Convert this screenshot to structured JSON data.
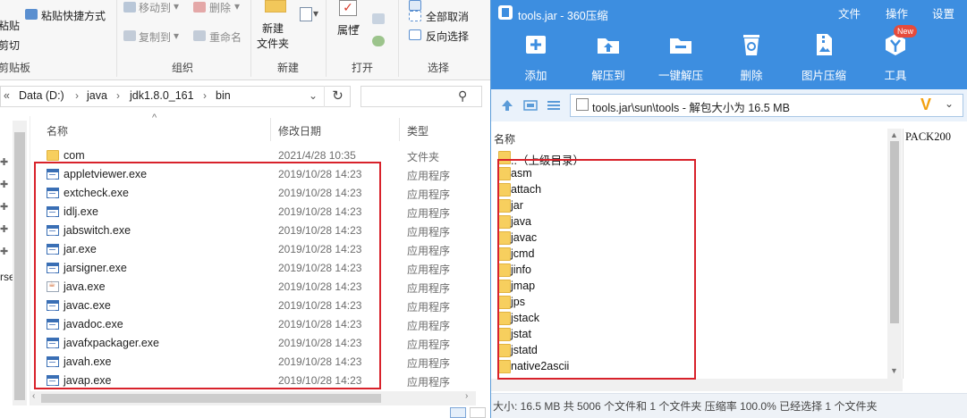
{
  "explorer": {
    "ribbon": {
      "paste_label": "粘贴",
      "paste_shortcut": "粘贴快捷方式",
      "cut": "剪切",
      "clipboard_group": "剪贴板",
      "move_to": "移动到",
      "copy_to": "复制到",
      "delete": "删除",
      "rename": "重命名",
      "organize_group": "组织",
      "new_folder": "新建\n文件夹",
      "new_folder_l1": "新建",
      "new_folder_l2": "文件夹",
      "new_group": "新建",
      "properties": "属性",
      "open_group": "打开",
      "select_all": "全部选择",
      "select_none": "全部取消",
      "invert_selection": "反向选择",
      "select_group": "选择"
    },
    "address": {
      "crumbs": [
        "Data (D:)",
        "java",
        "jdk1.8.0_161",
        "bin"
      ],
      "prefix": "«"
    },
    "columns": {
      "name": "名称",
      "date": "修改日期",
      "type": "类型"
    },
    "nav_label": "rse",
    "files": [
      {
        "name": "com",
        "date": "2021/4/28 10:35",
        "type": "文件夹",
        "icon": "folder"
      },
      {
        "name": "appletviewer.exe",
        "date": "2019/10/28 14:23",
        "type": "应用程序",
        "icon": "exe"
      },
      {
        "name": "extcheck.exe",
        "date": "2019/10/28 14:23",
        "type": "应用程序",
        "icon": "exe"
      },
      {
        "name": "idlj.exe",
        "date": "2019/10/28 14:23",
        "type": "应用程序",
        "icon": "exe"
      },
      {
        "name": "jabswitch.exe",
        "date": "2019/10/28 14:23",
        "type": "应用程序",
        "icon": "exe"
      },
      {
        "name": "jar.exe",
        "date": "2019/10/28 14:23",
        "type": "应用程序",
        "icon": "exe"
      },
      {
        "name": "jarsigner.exe",
        "date": "2019/10/28 14:23",
        "type": "应用程序",
        "icon": "exe"
      },
      {
        "name": "java.exe",
        "date": "2019/10/28 14:23",
        "type": "应用程序",
        "icon": "java"
      },
      {
        "name": "javac.exe",
        "date": "2019/10/28 14:23",
        "type": "应用程序",
        "icon": "exe"
      },
      {
        "name": "javadoc.exe",
        "date": "2019/10/28 14:23",
        "type": "应用程序",
        "icon": "exe"
      },
      {
        "name": "javafxpackager.exe",
        "date": "2019/10/28 14:23",
        "type": "应用程序",
        "icon": "exe"
      },
      {
        "name": "javah.exe",
        "date": "2019/10/28 14:23",
        "type": "应用程序",
        "icon": "exe"
      },
      {
        "name": "javap.exe",
        "date": "2019/10/28 14:23",
        "type": "应用程序",
        "icon": "exe"
      }
    ]
  },
  "zip": {
    "title": "tools.jar - 360压缩",
    "menu": [
      "文件",
      "操作",
      "设置"
    ],
    "toolbar": [
      {
        "label": "添加",
        "icon": "add-icon"
      },
      {
        "label": "解压到",
        "icon": "extract-to-icon"
      },
      {
        "label": "一键解压",
        "icon": "one-click-extract-icon"
      },
      {
        "label": "删除",
        "icon": "recycle-icon"
      },
      {
        "label": "图片压缩",
        "icon": "image-compress-icon"
      },
      {
        "label": "工具",
        "icon": "tools-icon"
      }
    ],
    "new_badge": "New",
    "path": "tools.jar\\sun\\tools - 解包大小为 16.5 MB",
    "column_name": "名称",
    "side_text": "PACK200",
    "entries": [
      "..（上级目录）",
      "asm",
      "attach",
      "jar",
      "java",
      "javac",
      "jcmd",
      "jinfo",
      "jmap",
      "jps",
      "jstack",
      "jstat",
      "jstatd",
      "native2ascii"
    ],
    "status": "大小: 16.5 MB 共 5006 个文件和 1 个文件夹 压缩率 100.0% 已经选择 1 个文件夹",
    "accent": "#3d8ee0"
  },
  "highlight_color": "#d8222b"
}
